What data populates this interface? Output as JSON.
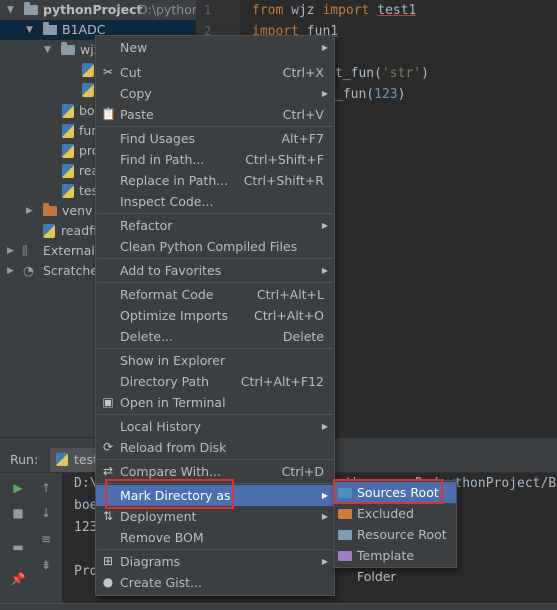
{
  "tree": {
    "project_label": "pythonProject",
    "project_path": "D:\\pythonP",
    "items": [
      {
        "label": "B1ADC"
      },
      {
        "label": "wjz"
      },
      {
        "label": ""
      },
      {
        "label": "bo"
      },
      {
        "label": "fun"
      },
      {
        "label": "pro"
      },
      {
        "label": "rea"
      },
      {
        "label": "tes"
      },
      {
        "label": "venv"
      },
      {
        "label": "readfi"
      },
      {
        "label": "External L"
      },
      {
        "label": "Scratches"
      }
    ]
  },
  "editor": {
    "line_numbers": [
      "1",
      "2"
    ],
    "lines": {
      "l1_from": "from",
      "l1_mod": "wjz",
      "l1_import": "import",
      "l1_name": "test1",
      "l2_import": "import",
      "l2_name": "fun1",
      "l4_call": "t_fun(",
      "l4_str": "'str'",
      "l4_close": ")",
      "l5_call": "_fun(",
      "l5_num": "123",
      "l5_close": ")"
    }
  },
  "run": {
    "label": "Run:",
    "tab_label": "test",
    "console_lines": [
      "D:\\",
      "boe",
      "123",
      "Pro"
    ],
    "console_path": "ython.exe D:/pythonProject/B"
  },
  "context_menu": {
    "items": [
      {
        "label": "New",
        "shortcut": "",
        "submenu": true
      },
      {
        "label": "Cut",
        "shortcut": "Ctrl+X",
        "icon": "scissors-icon"
      },
      {
        "label": "Copy",
        "shortcut": "",
        "submenu": true
      },
      {
        "label": "Paste",
        "shortcut": "Ctrl+V",
        "icon": "clipboard-icon"
      },
      {
        "label": "Find Usages",
        "shortcut": "Alt+F7"
      },
      {
        "label": "Find in Path...",
        "shortcut": "Ctrl+Shift+F"
      },
      {
        "label": "Replace in Path...",
        "shortcut": "Ctrl+Shift+R"
      },
      {
        "label": "Inspect Code...",
        "shortcut": ""
      },
      {
        "label": "Refactor",
        "shortcut": "",
        "submenu": true
      },
      {
        "label": "Clean Python Compiled Files",
        "shortcut": ""
      },
      {
        "label": "Add to Favorites",
        "shortcut": "",
        "submenu": true
      },
      {
        "label": "Reformat Code",
        "shortcut": "Ctrl+Alt+L"
      },
      {
        "label": "Optimize Imports",
        "shortcut": "Ctrl+Alt+O"
      },
      {
        "label": "Delete...",
        "shortcut": "Delete"
      },
      {
        "label": "Show in Explorer",
        "shortcut": ""
      },
      {
        "label": "Directory Path",
        "shortcut": "Ctrl+Alt+F12"
      },
      {
        "label": "Open in Terminal",
        "shortcut": "",
        "icon": "terminal-icon"
      },
      {
        "label": "Local History",
        "shortcut": "",
        "submenu": true
      },
      {
        "label": "Reload from Disk",
        "shortcut": "",
        "icon": "reload-icon"
      },
      {
        "label": "Compare With...",
        "shortcut": "Ctrl+D",
        "icon": "compare-icon"
      },
      {
        "label": "Mark Directory as",
        "shortcut": "",
        "submenu": true,
        "highlighted": true
      },
      {
        "label": "Deployment",
        "shortcut": "",
        "submenu": true,
        "icon": "deployment-icon"
      },
      {
        "label": "Remove BOM",
        "shortcut": ""
      },
      {
        "label": "Diagrams",
        "shortcut": "",
        "submenu": true,
        "icon": "diagram-icon"
      },
      {
        "label": "Create Gist...",
        "shortcut": "",
        "icon": "github-icon"
      }
    ]
  },
  "submenu": {
    "items": [
      {
        "label": "Sources Root",
        "color": "#4d8fbf",
        "highlighted": true
      },
      {
        "label": "Excluded",
        "color": "#d07a3c"
      },
      {
        "label": "Resource Root",
        "color": "#7f9bb0"
      },
      {
        "label": "Template Folder",
        "color": "#a07cc6"
      }
    ]
  },
  "colors": {
    "highlight": "#4b6eaf",
    "annotation_box": "#e0312e"
  }
}
